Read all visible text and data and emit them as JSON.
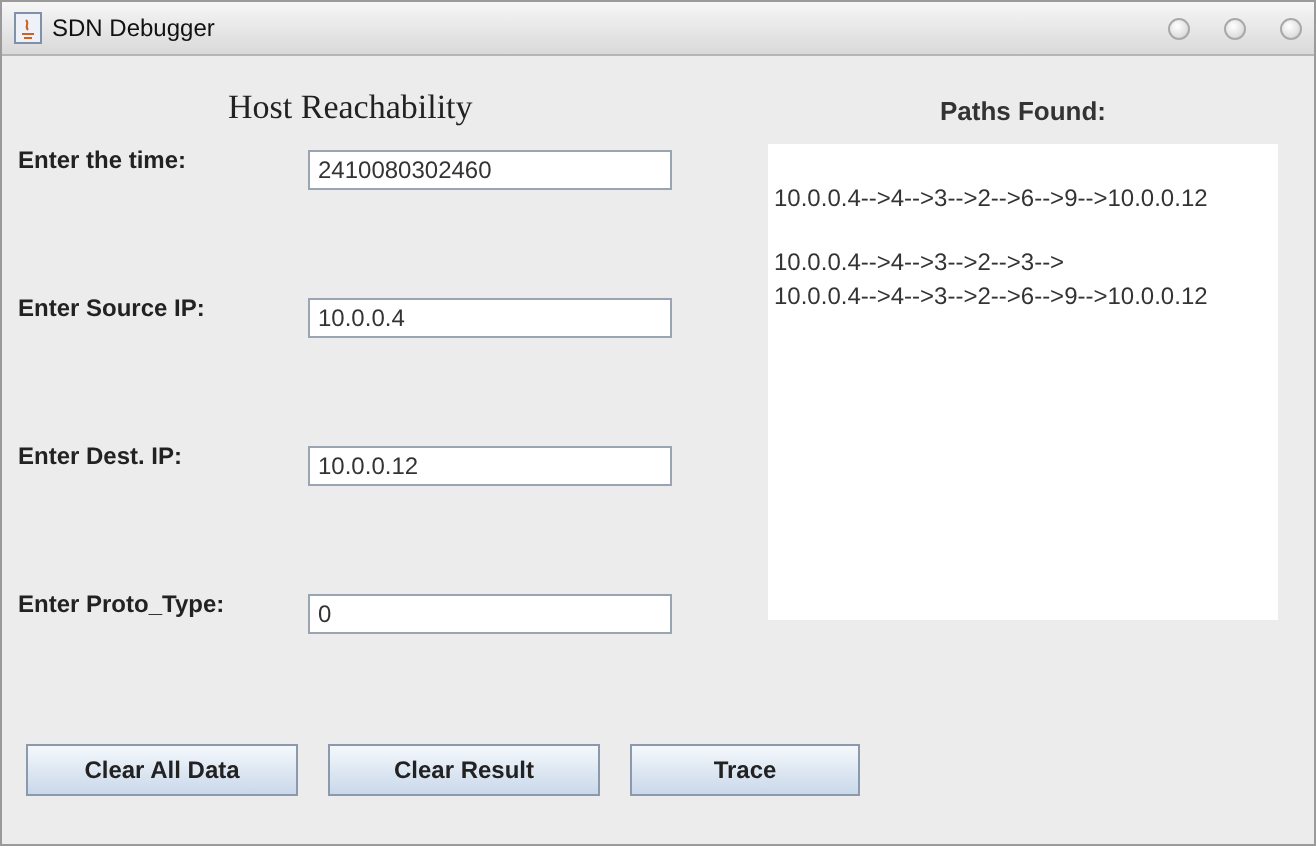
{
  "window": {
    "title": "SDN Debugger"
  },
  "form": {
    "title": "Host Reachability",
    "fields": [
      {
        "label": "Enter the time:",
        "value": "2410080302460"
      },
      {
        "label": "Enter Source IP:",
        "value": "10.0.0.4"
      },
      {
        "label": "Enter Dest. IP:",
        "value": "10.0.0.12"
      },
      {
        "label": "Enter Proto_Type:",
        "value": "0"
      }
    ]
  },
  "results": {
    "title": "Paths Found:",
    "groups": [
      [
        "10.0.0.4-->4-->3-->2-->6-->9-->10.0.0.12"
      ],
      [
        "10.0.0.4-->4-->3-->2-->3-->",
        "10.0.0.4-->4-->3-->2-->6-->9-->10.0.0.12"
      ]
    ]
  },
  "buttons": [
    "Clear All Data",
    "Clear Result",
    "Trace"
  ]
}
